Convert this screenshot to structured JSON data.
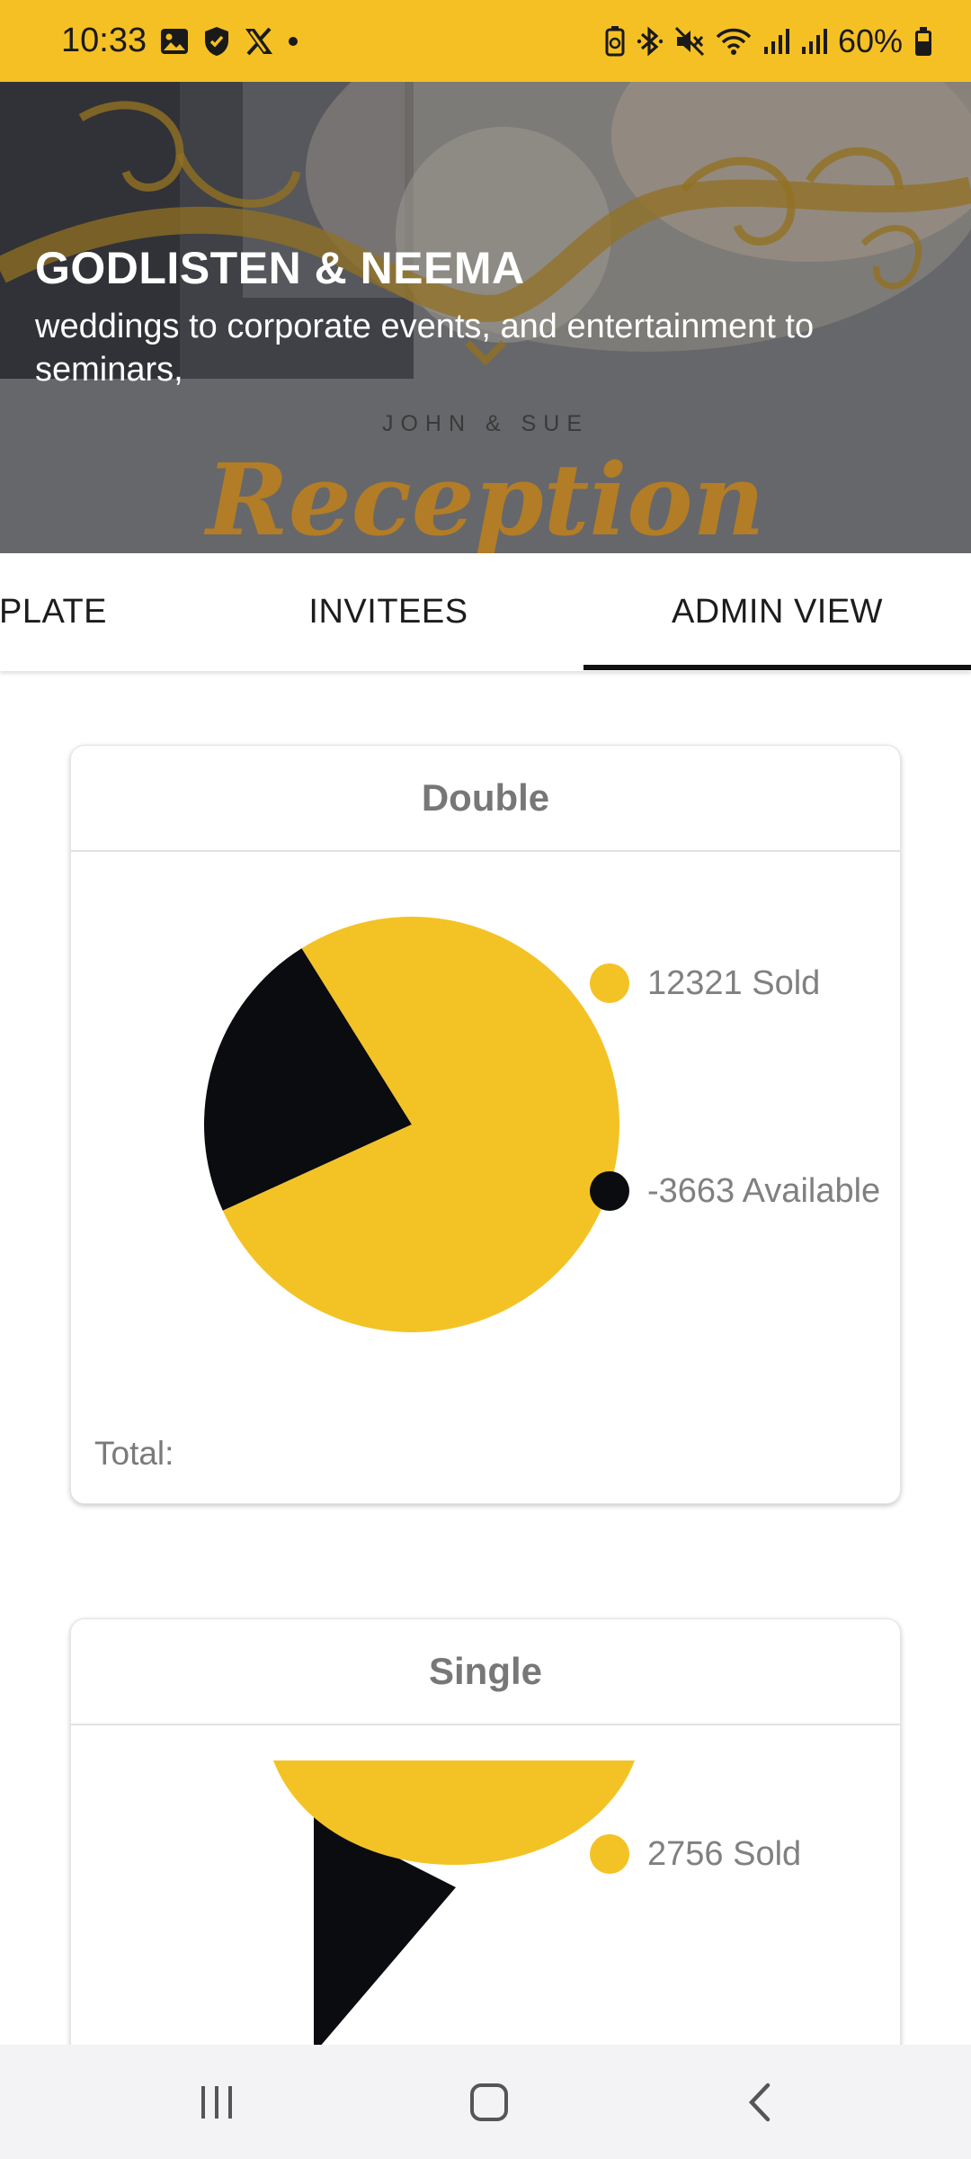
{
  "status_bar": {
    "time": "10:33",
    "battery": "60%",
    "left_icons": [
      "gallery-icon",
      "shield-check-icon",
      "x-logo-icon",
      "dot-icon"
    ],
    "right_icons": [
      "battery-saver-icon",
      "bluetooth-icon",
      "mute-icon",
      "wifi-icon",
      "signal-icon",
      "signal-icon",
      "battery-icon"
    ]
  },
  "hero": {
    "title": "GODLISTEN & NEEMA",
    "subtitle": "weddings to corporate events, and entertainment to seminars,",
    "couple_text": "JOHN & SUE",
    "script_text": "Reception"
  },
  "tabs": [
    {
      "label": "PLATE",
      "active": false
    },
    {
      "label": "INVITEES",
      "active": false
    },
    {
      "label": "ADMIN VIEW",
      "active": true
    }
  ],
  "cards": [
    {
      "title": "Double",
      "legend": [
        {
          "label": "12321 Sold",
          "color": "#f3c326"
        },
        {
          "label": "-3663 Available",
          "color": "#0b0c10"
        }
      ],
      "total_label": "Total:"
    },
    {
      "title": "Single",
      "legend": [
        {
          "label": "2756 Sold",
          "color": "#f3c326"
        }
      ]
    }
  ],
  "chart_data": [
    {
      "type": "pie",
      "title": "Double",
      "categories": [
        "Sold",
        "Available"
      ],
      "values": [
        12321,
        -3663
      ],
      "colors": [
        "#f3c326",
        "#0b0c10"
      ]
    },
    {
      "type": "pie",
      "title": "Single",
      "categories": [
        "Sold"
      ],
      "values": [
        2756
      ],
      "colors": [
        "#f3c326",
        "#0b0c10"
      ]
    }
  ],
  "colors": {
    "accent": "#f5c024",
    "pie_yellow": "#f3c326",
    "pie_black": "#0b0c10"
  },
  "nav_bar": {
    "buttons": [
      "recents-icon",
      "home-icon",
      "back-icon"
    ]
  }
}
